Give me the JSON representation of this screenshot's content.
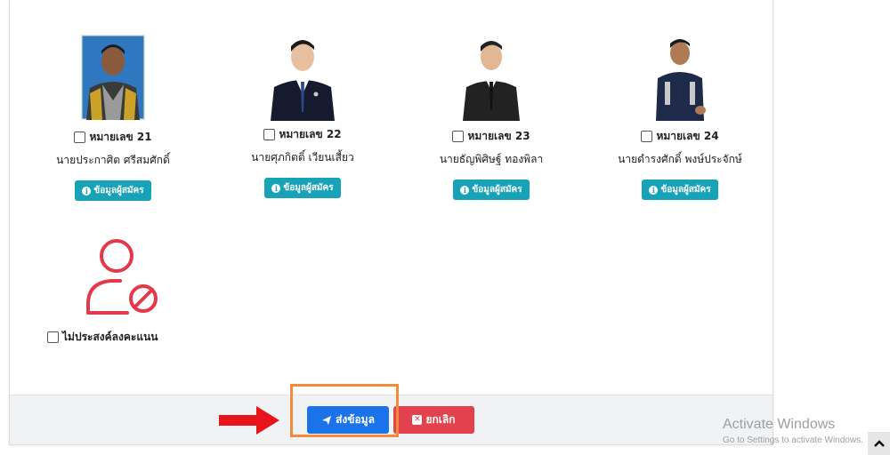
{
  "candidates": [
    {
      "number_label": "หมายเลข 21",
      "name": "นายประกาศิต ศรีสมศักดิ์",
      "info_label": "ข้อมูลผู้สมัคร"
    },
    {
      "number_label": "หมายเลข 22",
      "name": "นายศุภกิตติ์ เวียนเสี้ยว",
      "info_label": "ข้อมูลผู้สมัคร"
    },
    {
      "number_label": "หมายเลข 23",
      "name": "นายธัญพิศิษฐ์ ทองพิลา",
      "info_label": "ข้อมูลผู้สมัคร"
    },
    {
      "number_label": "หมายเลข 24",
      "name": "นายดำรงศักดิ์ พงษ์ประจักษ์",
      "info_label": "ข้อมูลผู้สมัคร"
    }
  ],
  "no_vote": {
    "label": "ไม่ประสงค์ลงคะแนน",
    "icon": "user-slash-icon"
  },
  "actions": {
    "submit_label": "ส่งข้อมูล",
    "cancel_label": "ยกเลิก"
  },
  "watermark": {
    "title": "Activate Windows",
    "subtitle": "Go to Settings to activate Windows."
  },
  "colors": {
    "info": "#17a2b8",
    "submit": "#1a73e8",
    "cancel": "#e1424e",
    "highlight": "#f28b3c",
    "arrow": "#e8141b",
    "no_vote_icon": "#e23a4a"
  }
}
